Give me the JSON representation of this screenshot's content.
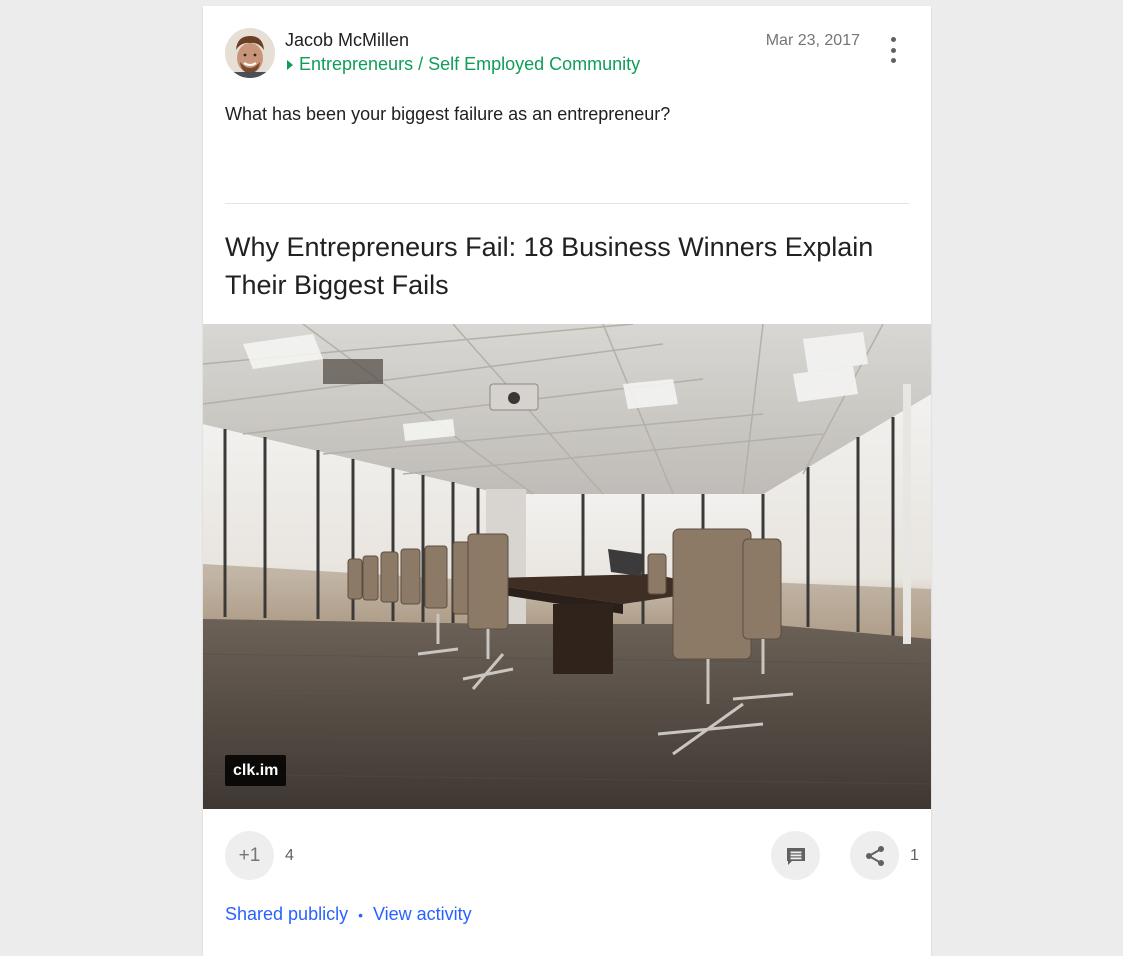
{
  "post": {
    "author_name": "Jacob McMillen",
    "community": "Entrepreneurs / Self Employed Community",
    "date": "Mar 23, 2017",
    "text": "What has been your biggest failure as an entrepreneur?"
  },
  "link": {
    "title": "Why Entrepreneurs Fail: 18 Business Winners Explain Their Biggest Fails",
    "domain": "clk.im"
  },
  "actions": {
    "plus_one_label": "+1",
    "plus_one_count": "4",
    "share_count": "1"
  },
  "footer": {
    "shared_publicly": "Shared publicly",
    "separator": "•",
    "view_activity": "View activity"
  },
  "icons": {
    "more": "more-vert-icon",
    "comment": "comment-icon",
    "share": "share-icon",
    "community_arrow": "triangle-right-icon"
  },
  "colors": {
    "community": "#0f9d58",
    "link": "#2962ff",
    "background": "#ececec"
  }
}
